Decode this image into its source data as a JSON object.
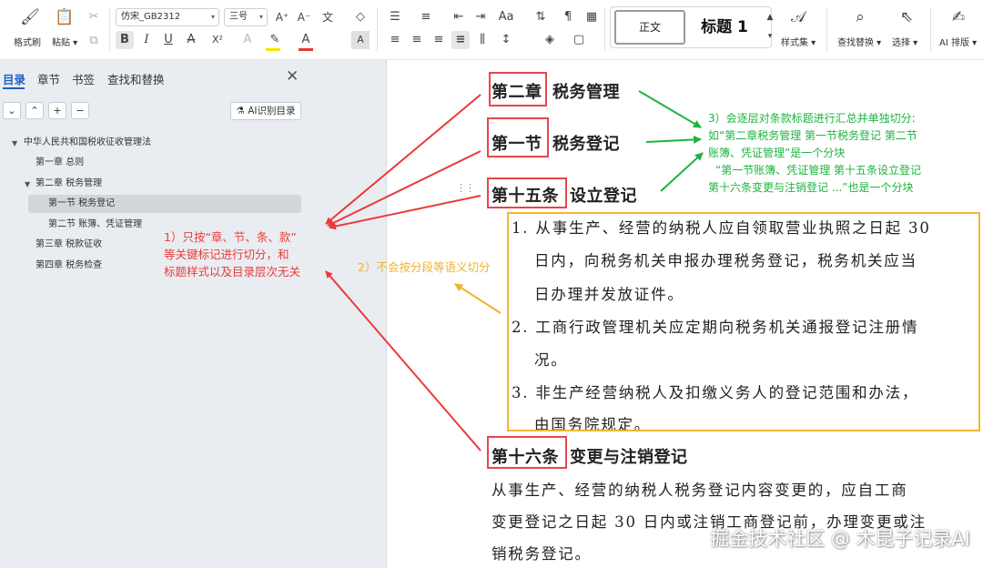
{
  "toolbar": {
    "format_painter": "格式刷",
    "paste": "粘贴",
    "font_name": "仿宋_GB2312",
    "font_size": "三号",
    "style_normal": "正文",
    "style_heading1": "标题 1",
    "style_set": "样式集",
    "find_replace": "查找替换",
    "select": "选择",
    "ai_layout": "AI 排版",
    "bold": "B",
    "italic": "I",
    "underline": "U",
    "strike": "A",
    "superscript": "X²",
    "font_color": "A",
    "char_shade": "A"
  },
  "sidebar": {
    "tabs": [
      "目录",
      "章节",
      "书签",
      "查找和替换"
    ],
    "ai_button": "AI识别目录",
    "toc": [
      {
        "label": "中华人民共和国税收征收管理法",
        "level": 0,
        "expanded": true
      },
      {
        "label": "第一章 总则",
        "level": 1
      },
      {
        "label": "第二章 税务管理",
        "level": 1,
        "expanded": true
      },
      {
        "label": "第一节 税务登记",
        "level": 2,
        "selected": true
      },
      {
        "label": "第二节 账簿、凭证管理",
        "level": 2
      },
      {
        "label": "第三章 税款征收",
        "level": 1
      },
      {
        "label": "第四章 税务检查",
        "level": 1
      }
    ]
  },
  "document": {
    "chapter_num": "第二章",
    "chapter_title": "税务管理",
    "section_num": "第一节",
    "section_title": "税务登记",
    "article15_num": "第十五条",
    "article15_title": "设立登记",
    "para_lines": [
      "1. 从事生产、经营的纳税人应自领取营业执照之日起 30",
      "日内，向税务机关申报办理税务登记，税务机关应当",
      "日办理并发放证件。",
      "2. 工商行政管理机关应定期向税务机关通报登记注册情",
      "况。",
      "3. 非生产经营纳税人及扣缴义务人的登记范围和办法，",
      "由国务院规定。"
    ],
    "article16_num": "第十六条",
    "article16_title": "变更与注销登记",
    "article16_lines": [
      "从事生产、经营的纳税人税务登记内容变更的，应自工商",
      "变更登记之日起 30 日内或注销工商登记前，办理变更或注",
      "销税务登记。"
    ]
  },
  "annotations": {
    "red": [
      "1）只按“章、节、条、款”",
      "等关键标记进行切分，和",
      "标题样式以及目录层次无关"
    ],
    "yellow": "2）不会按分段等语义切分",
    "green": [
      "3）会逐层对条款标题进行汇总并单独切分:",
      "如“第二章税务管理 第一节税务登记 第二节",
      "账簿、凭证管理”是一个分块",
      "“第一节账簿、凭证管理 第十五条设立登记",
      "第十六条变更与注销登记 ...”也是一个分块"
    ],
    "colors": {
      "red": "#ea3a3a",
      "green": "#1db43e",
      "yellow": "#f1b22e"
    }
  },
  "watermark": "掘金技术社区 @ 木昆子记录AI"
}
